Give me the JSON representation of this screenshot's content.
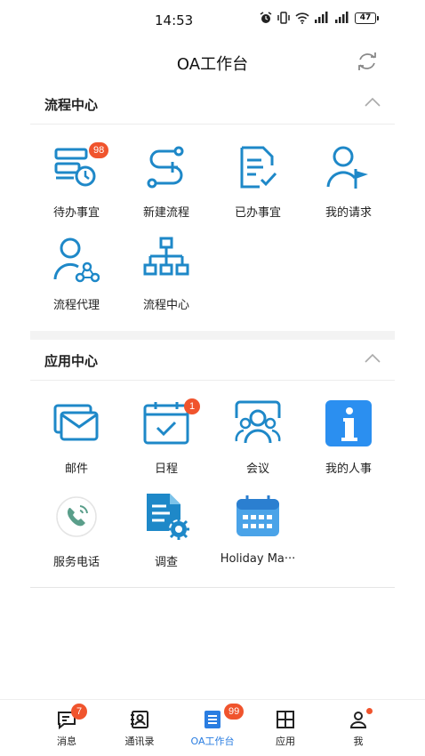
{
  "status_bar": {
    "time": "14:53",
    "battery": "47"
  },
  "header": {
    "title": "OA工作台"
  },
  "process_center": {
    "title": "流程中心",
    "items": [
      {
        "label": "待办事宜",
        "badge": "98"
      },
      {
        "label": "新建流程"
      },
      {
        "label": "已办事宜"
      },
      {
        "label": "我的请求"
      },
      {
        "label": "流程代理"
      },
      {
        "label": "流程中心"
      }
    ]
  },
  "app_center": {
    "title": "应用中心",
    "items": [
      {
        "label": "邮件"
      },
      {
        "label": "日程",
        "badge": "1"
      },
      {
        "label": "会议"
      },
      {
        "label": "我的人事"
      },
      {
        "label": "服务电话"
      },
      {
        "label": "调查"
      },
      {
        "label": "Holiday Ma···"
      }
    ]
  },
  "tabbar": {
    "tabs": [
      {
        "label": "消息",
        "badge": "7"
      },
      {
        "label": "通讯录"
      },
      {
        "label": "OA工作台",
        "badge": "99"
      },
      {
        "label": "应用"
      },
      {
        "label": "我"
      }
    ]
  },
  "colors": {
    "accent": "#2a7de1",
    "icon_blue": "#1e88c8",
    "badge": "#f0542d"
  }
}
